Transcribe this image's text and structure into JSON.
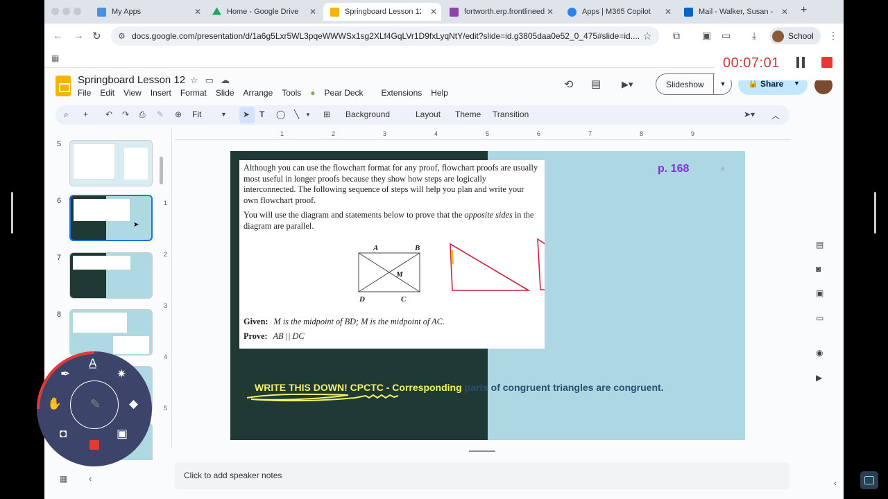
{
  "browser": {
    "tabs": [
      {
        "label": "My Apps",
        "color": "#4a90e2"
      },
      {
        "label": "Home - Google Drive",
        "color": "#1fa463"
      },
      {
        "label": "Springboard Lesson 12 -",
        "color": "#f4b400",
        "active": true
      },
      {
        "label": "fortworth.erp.frontlineed",
        "color": "#8e44ad"
      },
      {
        "label": "Apps | M365 Copilot",
        "color": "#2f80ed"
      },
      {
        "label": "Mail - Walker, Susan - O",
        "color": "#0a64c8"
      }
    ],
    "url": "docs.google.com/presentation/d/1a6g5Lxr5WL3pqeWWWSx1sg2XLf4GqLVr1D9fxLyqNtY/edit?slide=id.g3805daa0e52_0_475#slide=id....",
    "profile": "School"
  },
  "recorder": {
    "time": "00:07:01"
  },
  "doc": {
    "title": "Springboard Lesson 12",
    "menu": [
      "File",
      "Edit",
      "View",
      "Insert",
      "Format",
      "Slide",
      "Arrange",
      "Tools",
      "Pear Deck",
      "Extensions",
      "Help"
    ],
    "slideshow": "Slideshow",
    "share": "Share"
  },
  "toolbar": {
    "zoom": "Fit",
    "background": "Background",
    "layout": "Layout",
    "theme": "Theme",
    "transition": "Transition"
  },
  "filmstrip": {
    "slides": [
      "5",
      "6",
      "7",
      "8"
    ]
  },
  "ruler": {
    "h": [
      "1",
      "2",
      "3",
      "4",
      "5",
      "6",
      "7",
      "8",
      "9"
    ],
    "v": [
      "1",
      "2",
      "3",
      "4",
      "5"
    ]
  },
  "slide": {
    "page_ref": "p. 168",
    "tiny_mark": "6",
    "para1": "Although you can use the flowchart format for any proof, flowchart proofs are usually most useful in longer proofs because they show how steps are logically interconnected. The following sequence of steps will help you plan and write your own flowchart proof.",
    "para2_a": "You will use the diagram and statements below to prove that the ",
    "para2_em": "opposite sides",
    "para2_b": " in the diagram are parallel.",
    "labels": {
      "a": "A",
      "b": "B",
      "c": "C",
      "d": "D",
      "m": "M"
    },
    "given_label": "Given:",
    "given_text": "M is the midpoint of BD; M is the midpoint of AC.",
    "prove_label": "Prove:",
    "prove_text": "AB || DC",
    "cpctc_yellow": "WRITE THIS DOWN!  CPCTC - Corresponding ",
    "cpctc_blue": "parts of congruent triangles are congruent."
  },
  "notes": {
    "placeholder": "Click to add speaker notes"
  }
}
